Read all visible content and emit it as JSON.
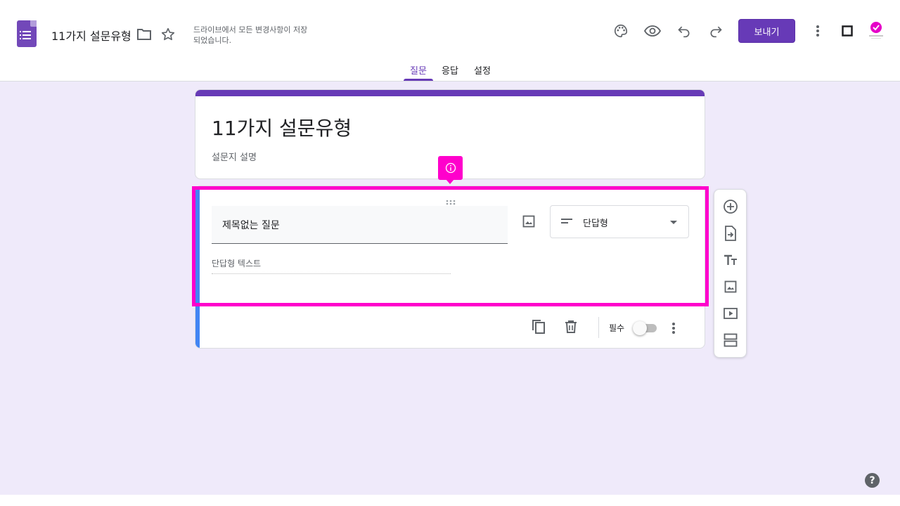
{
  "header": {
    "doc_title": "11가지 설문유형",
    "save_status": "드라이브에서 모든 변경사항이 저장되었습니다.",
    "send_label": "보내기",
    "icons": [
      "form-logo-icon",
      "folder-icon",
      "star-icon",
      "palette-icon",
      "preview-eye-icon",
      "undo-icon",
      "redo-icon",
      "more-vert-icon",
      "square-icon",
      "avatar"
    ]
  },
  "tabs": [
    {
      "label": "질문",
      "active": true
    },
    {
      "label": "응답",
      "active": false
    },
    {
      "label": "설정",
      "active": false
    }
  ],
  "form": {
    "title": "11가지 설문유형",
    "description": "설문지 설명"
  },
  "question": {
    "title": "제목없는 질문",
    "type_label": "단답형",
    "answer_placeholder": "단답형 텍스트",
    "required_label": "필수",
    "required": false
  },
  "side_toolbar": [
    "add-question-icon",
    "import-questions-icon",
    "add-title-icon",
    "add-image-icon",
    "add-video-icon",
    "add-section-icon"
  ],
  "colors": {
    "accent": "#673ab7",
    "canvas_bg": "#efeafa",
    "highlight": "#ff00cc",
    "active_bar": "#4285f4"
  }
}
